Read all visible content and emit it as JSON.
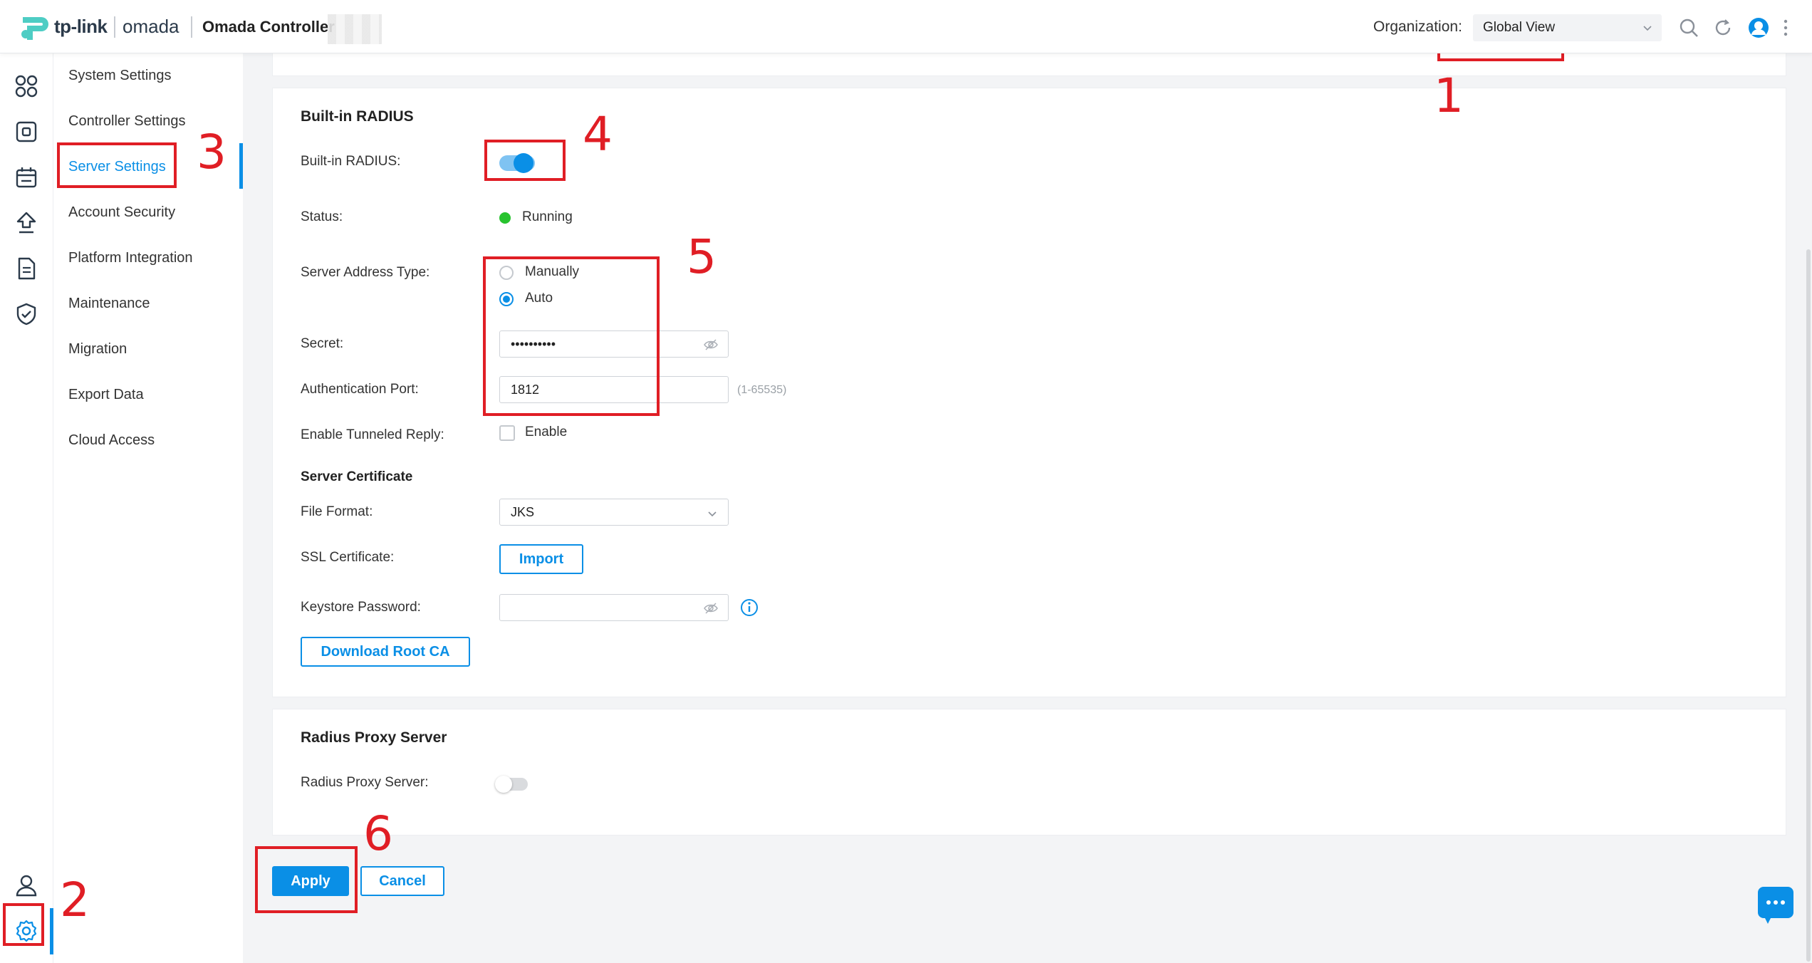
{
  "header": {
    "brand_tplink": "tp-link",
    "brand_omada": "omada",
    "app_title": "Omada Controller",
    "organization_label": "Organization:",
    "organization_value": "Global View"
  },
  "rail": {
    "items": [
      "dashboard-icon",
      "devices-icon",
      "schedule-icon",
      "upgrade-icon",
      "logs-icon",
      "security-icon",
      "account-icon",
      "settings-icon"
    ],
    "active": "settings-icon"
  },
  "submenu": {
    "items": [
      {
        "label": "System Settings"
      },
      {
        "label": "Controller Settings"
      },
      {
        "label": "Server Settings"
      },
      {
        "label": "Account Security"
      },
      {
        "label": "Platform Integration"
      },
      {
        "label": "Maintenance"
      },
      {
        "label": "Migration"
      },
      {
        "label": "Export Data"
      },
      {
        "label": "Cloud Access"
      }
    ],
    "active": "Server Settings"
  },
  "radius": {
    "section_title": "Built-in RADIUS",
    "enable_label": "Built-in RADIUS:",
    "enabled": true,
    "status_label": "Status:",
    "status_value": "Running",
    "status_color": "#27c32e",
    "address_type_label": "Server Address Type:",
    "address_options": [
      "Manually",
      "Auto"
    ],
    "address_selected": "Auto",
    "secret_label": "Secret:",
    "secret_value": "••••••••••",
    "auth_port_label": "Authentication Port:",
    "auth_port_value": "1812",
    "auth_port_hint": "(1-65535)",
    "tunneled_label": "Enable Tunneled Reply:",
    "tunneled_option": "Enable",
    "tunneled_checked": false,
    "cert_title": "Server Certificate",
    "file_format_label": "File Format:",
    "file_format_value": "JKS",
    "ssl_label": "SSL Certificate:",
    "import_button": "Import",
    "keystore_label": "Keystore Password:",
    "keystore_value": "",
    "download_button": "Download Root CA"
  },
  "proxy": {
    "section_title": "Radius Proxy Server",
    "label": "Radius Proxy Server:",
    "enabled": false
  },
  "actions": {
    "apply": "Apply",
    "cancel": "Cancel"
  },
  "annotations": [
    "1",
    "2",
    "3",
    "4",
    "5",
    "6"
  ],
  "colors": {
    "accent": "#0a8fe6",
    "annotation": "#e01e25"
  }
}
